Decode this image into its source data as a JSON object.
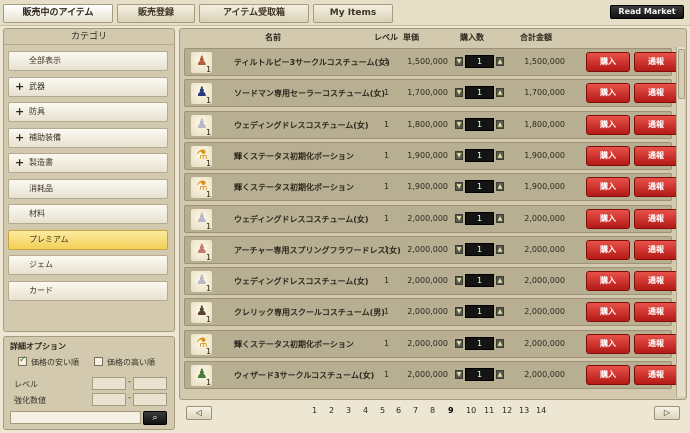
{
  "tabs": [
    "販売中のアイテム",
    "販売登録",
    "アイテム受取箱",
    "My Items"
  ],
  "read_market": "Read Market",
  "sidebar": {
    "header": "カテゴリ",
    "items": [
      {
        "label": "全部表示",
        "plus": ""
      },
      {
        "label": "武器",
        "plus": "+"
      },
      {
        "label": "防具",
        "plus": "+"
      },
      {
        "label": "補助装備",
        "plus": "+"
      },
      {
        "label": "製造書",
        "plus": "+"
      },
      {
        "label": "消耗品",
        "plus": ""
      },
      {
        "label": "材料",
        "plus": ""
      },
      {
        "label": "プレミアム",
        "plus": ""
      },
      {
        "label": "ジェム",
        "plus": ""
      },
      {
        "label": "カード",
        "plus": ""
      }
    ]
  },
  "options": {
    "title": "詳細オプション",
    "sort_low": "価格の安い順",
    "sort_high": "価格の高い順",
    "level": "レベル",
    "enhance": "強化数値",
    "search_icon": "⌕"
  },
  "table": {
    "headers": {
      "name": "名前",
      "level": "レベル",
      "price": "単価",
      "qty": "購入数",
      "total": "合計金額"
    },
    "buy_label": "購入",
    "report_label": "通報",
    "rows": [
      {
        "name": "ティルトルピー3サークルコスチューム(女)",
        "level": "1",
        "price": "1,500,000",
        "qty": "1",
        "total": "1,500,000",
        "count": "1",
        "glyph": "♟",
        "color": "#b0603a"
      },
      {
        "name": "ソードマン専用セーラーコスチューム(女)",
        "level": "1",
        "price": "1,700,000",
        "qty": "1",
        "total": "1,700,000",
        "count": "1",
        "glyph": "♟",
        "color": "#2a3a7a"
      },
      {
        "name": "ウェディングドレスコスチューム(女)",
        "level": "1",
        "price": "1,800,000",
        "qty": "1",
        "total": "1,800,000",
        "count": "1",
        "glyph": "♟",
        "color": "#b8b8c8"
      },
      {
        "name": "輝くステータス初期化ポーション",
        "level": "1",
        "price": "1,900,000",
        "qty": "1",
        "total": "1,900,000",
        "count": "1",
        "glyph": "⚗",
        "color": "#d8941a"
      },
      {
        "name": "輝くステータス初期化ポーション",
        "level": "1",
        "price": "1,900,000",
        "qty": "1",
        "total": "1,900,000",
        "count": "1",
        "glyph": "⚗",
        "color": "#d8941a"
      },
      {
        "name": "ウェディングドレスコスチューム(女)",
        "level": "1",
        "price": "2,000,000",
        "qty": "1",
        "total": "2,000,000",
        "count": "1",
        "glyph": "♟",
        "color": "#b8b8c8"
      },
      {
        "name": "アーチャー専用スプリングフラワードレス(女)",
        "level": "1",
        "price": "2,000,000",
        "qty": "1",
        "total": "2,000,000",
        "count": "1",
        "glyph": "♟",
        "color": "#c27a6a"
      },
      {
        "name": "ウェディングドレスコスチューム(女)",
        "level": "1",
        "price": "2,000,000",
        "qty": "1",
        "total": "2,000,000",
        "count": "1",
        "glyph": "♟",
        "color": "#b8b8c8"
      },
      {
        "name": "クレリック専用スクールコスチューム(男)",
        "level": "1",
        "price": "2,000,000",
        "qty": "1",
        "total": "2,000,000",
        "count": "1",
        "glyph": "♟",
        "color": "#5a4430"
      },
      {
        "name": "輝くステータス初期化ポーション",
        "level": "1",
        "price": "2,000,000",
        "qty": "1",
        "total": "2,000,000",
        "count": "1",
        "glyph": "⚗",
        "color": "#d8941a"
      },
      {
        "name": "ウィザード3サークルコスチューム(女)",
        "level": "1",
        "price": "2,000,000",
        "qty": "1",
        "total": "2,000,000",
        "count": "1",
        "glyph": "♟",
        "color": "#4a7a3a"
      }
    ]
  },
  "pager": {
    "prev": "◁",
    "next": "▷",
    "pages": [
      "1",
      "2",
      "3",
      "4",
      "5",
      "6",
      "7",
      "8",
      "9",
      "10",
      "11",
      "12",
      "13",
      "14"
    ],
    "current": "9"
  }
}
